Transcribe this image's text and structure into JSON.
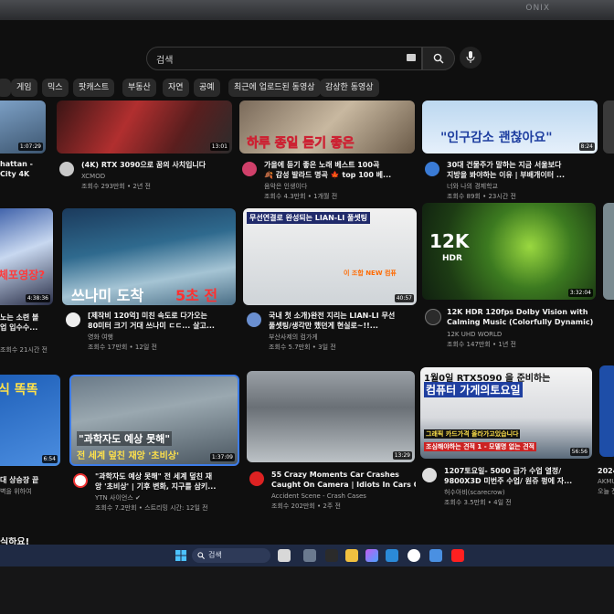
{
  "monitor": {
    "brand": "ONIX"
  },
  "search": {
    "placeholder": "검색"
  },
  "chips": [
    "게임",
    "믹스",
    "팟캐스트",
    "부동산",
    "자연",
    "공예",
    "최근에 업로드된 동영상",
    "감상한 동영상"
  ],
  "videos": [
    {
      "title": "hattan -",
      "title2": "City 4K",
      "channel": "",
      "meta": "",
      "duration": "1:07:29"
    },
    {
      "title": "(4K) RTX 3090으로 꿈의 사치입니다",
      "channel": "XCMOD",
      "meta": "조회수 293만회 • 2년 전",
      "duration": "13:01"
    },
    {
      "title": "가을에 듣기 좋은 노래 베스트 100곡",
      "title2": "🍂 감성 발라드 명곡 🍁 top 100 베...",
      "channel": "음악은 인생이다",
      "meta": "조회수 4.3만회 • 1개월 전",
      "duration": "",
      "thumb_text": "하루 종일 듣기 좋은"
    },
    {
      "title": "30대 건물주가 말하는 지금 서울보다",
      "title2": "지방을 봐야하는 이유 | 부배개이터 ...",
      "channel": "너와 나의 경제학교",
      "meta": "조회수 89회 • 23시간 전",
      "duration": "8:24",
      "thumb_text": "\"인구감소 괜찮아요\""
    },
    {
      "title": "노는 소련 볼",
      "title2": "업 입수수...",
      "channel": "",
      "meta": "조회수 21시간 전",
      "duration": "4:38:36",
      "thumb_text": "체포영장?"
    },
    {
      "title": "[제작비 120억] 미친 속도로 다가오는",
      "title2": "80미터 크기 거대 쓰나미 ㄷㄷ... 살고...",
      "channel": "영화 여행",
      "meta": "조회수 17만회 • 12일 전",
      "duration": "",
      "thumb_text": "쓰나미 도착",
      "thumb_text2": "5초 전"
    },
    {
      "title": "국내 첫 소개)완전 지리는 LIAN-LI 무선",
      "title2": "풀셋팅/생각만 했던게 현실로~!!...",
      "channel": "부산사제의 컴가게",
      "meta": "조회수 5.7만회 • 3일 전",
      "duration": "40:57",
      "thumb_text": "무선연결로 완성되는 LIAN-LI 풀셋팅",
      "thumb_text2": "이 조합 NEW 컴퓨"
    },
    {
      "title": "12K HDR 120fps Dolby Vision with",
      "title2": "Calming Music (Colorfully Dynamic)",
      "channel": "12K UHD WORLD",
      "meta": "조회수 147만회 • 1년 전",
      "duration": "3:32:04",
      "thumb_text": "12K",
      "thumb_text2": "HDR"
    },
    {
      "title": "대 상승장 끝",
      "title2": "벽을 위하여",
      "channel": "",
      "meta": "",
      "duration": "6:54",
      "thumb_text": "식 똑똑"
    },
    {
      "title": "\"과학자도 예상 못해\" 전 세계 덮친 재",
      "title2": "앙 '초비상' | 기후 변화, 지구를 삼키...",
      "channel": "YTN 사이언스 ✔",
      "meta": "조회수 7.2만회 • 스트리밍 시간: 12일 전",
      "duration": "1:37:09",
      "thumb_text": "\"과학자도 예상 못해\"",
      "thumb_text2": "전 세계 덮친 재앙 '초비상'"
    },
    {
      "title": "55 Crazy Moments Car Crashes",
      "title2": "Caught On Camera | Idiots In Cars G...",
      "channel": "Accident Scene - Crash Cases",
      "meta": "조회수 202만회 • 2주 전",
      "duration": "13:29",
      "thumb_text": ""
    },
    {
      "title": "1207토요일- 5000 급가 수업 열정/",
      "title2": "9800X3D 미번주 수업/ 원쥬 펑에 자...",
      "channel": "허수아비(scarecrow)",
      "meta": "조회수 3.5만회 • 4일 전",
      "duration": "56:56",
      "thumb_text": "1월0일 RTX5090 을 준비하는",
      "thumb_text2": "컴퓨터 가게의토요일",
      "thumb_text3": "그래픽 카드가격 올라가고있습니다",
      "thumb_text4": "조심해야하는 견적 1 - 모델명 없는 견적"
    }
  ],
  "partial_right": [
    "2024",
    "AKMU",
    "오늘 전"
  ],
  "bottom_heading": "식하요!",
  "taskbar": {
    "search_label": "검색"
  },
  "colors": {
    "accent": "#ff0000",
    "taskbar": "#1f2a44"
  }
}
